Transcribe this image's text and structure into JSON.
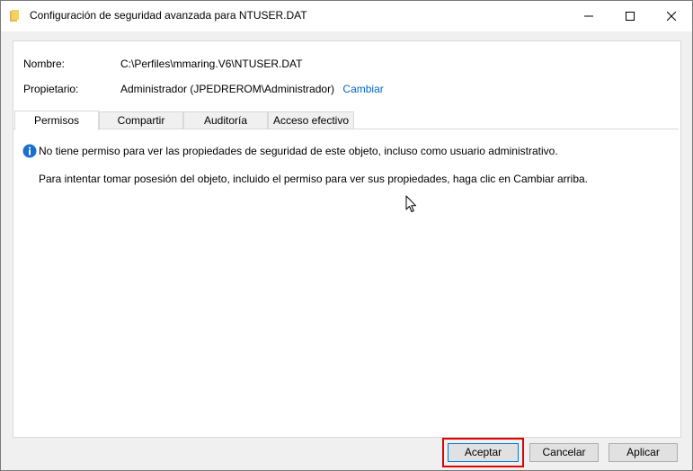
{
  "window": {
    "title": "Configuración de seguridad avanzada para NTUSER.DAT",
    "title_icon": "folder-icon",
    "controls": {
      "minimize": "minimize-icon",
      "maximize": "maximize-icon",
      "close": "close-icon"
    }
  },
  "details": {
    "name_label": "Nombre:",
    "name_value": "C:\\Perfiles\\mmaring.V6\\NTUSER.DAT",
    "owner_label": "Propietario:",
    "owner_value": "Administrador (JPEDREROM\\Administrador)",
    "owner_change_link": "Cambiar"
  },
  "tabs": [
    {
      "label": "Permisos",
      "active": true
    },
    {
      "label": "Compartir",
      "active": false
    },
    {
      "label": "Auditoría",
      "active": false
    },
    {
      "label": "Acceso efectivo",
      "active": false
    }
  ],
  "panel": {
    "info_icon": "info-icon",
    "info_message": "No tiene permiso para ver las propiedades de seguridad de este objeto, incluso como usuario administrativo.",
    "hint_message": "Para intentar tomar posesión del objeto, incluido el permiso para ver sus propiedades, haga clic en Cambiar arriba."
  },
  "buttons": {
    "ok": "Aceptar",
    "cancel": "Cancelar",
    "apply": "Aplicar"
  },
  "colors": {
    "link": "#0066cc",
    "focus_border": "#0078d7",
    "highlight": "#e00000",
    "info_icon": "#1a6fd1"
  }
}
